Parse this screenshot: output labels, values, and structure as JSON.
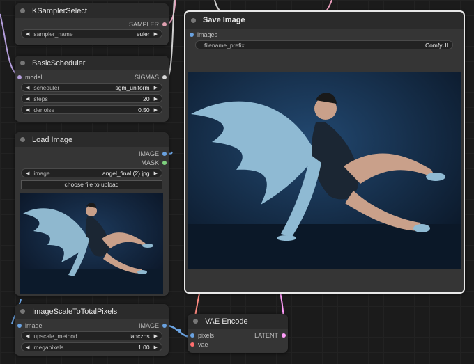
{
  "nodes": {
    "ksampler_select": {
      "title": "KSamplerSelect",
      "output": "SAMPLER",
      "widgets": [
        {
          "name": "sampler_name",
          "value": "euler"
        }
      ]
    },
    "basic_scheduler": {
      "title": "BasicScheduler",
      "input": "model",
      "output": "SIGMAS",
      "widgets": [
        {
          "name": "scheduler",
          "value": "sgm_uniform"
        },
        {
          "name": "steps",
          "value": "20"
        },
        {
          "name": "denoise",
          "value": "0.50"
        }
      ]
    },
    "load_image": {
      "title": "Load Image",
      "outputs": [
        "IMAGE",
        "MASK"
      ],
      "widgets": [
        {
          "name": "image",
          "value": "angel_final (2).jpg"
        }
      ],
      "upload_button": "choose file to upload"
    },
    "image_scale": {
      "title": "ImageScaleToTotalPixels",
      "input": "image",
      "output": "IMAGE",
      "widgets": [
        {
          "name": "upscale_method",
          "value": "lanczos"
        },
        {
          "name": "megapixels",
          "value": "1.00"
        }
      ]
    },
    "save_image": {
      "title": "Save Image",
      "input": "images",
      "widgets": [
        {
          "name": "filename_prefix",
          "value": "ComfyUI"
        }
      ]
    },
    "vae_encode": {
      "title": "VAE Encode",
      "inputs": [
        "pixels",
        "vae"
      ],
      "output": "LATENT"
    }
  },
  "colors": {
    "canvas": "#1b1b1b",
    "node_body": "#353535",
    "node_header": "#2b2b2b",
    "slot_image": "#6aa2e0",
    "slot_mask": "#7ed17e",
    "slot_sampler": "#e0a0b0",
    "slot_sigmas": "#d8d8d8",
    "slot_model": "#b39ddb",
    "slot_latent": "#ff9cf9",
    "slot_vae": "#ff6e6e",
    "wire_sampler": "#e59ab8",
    "wire_vae": "#ff8a80"
  }
}
